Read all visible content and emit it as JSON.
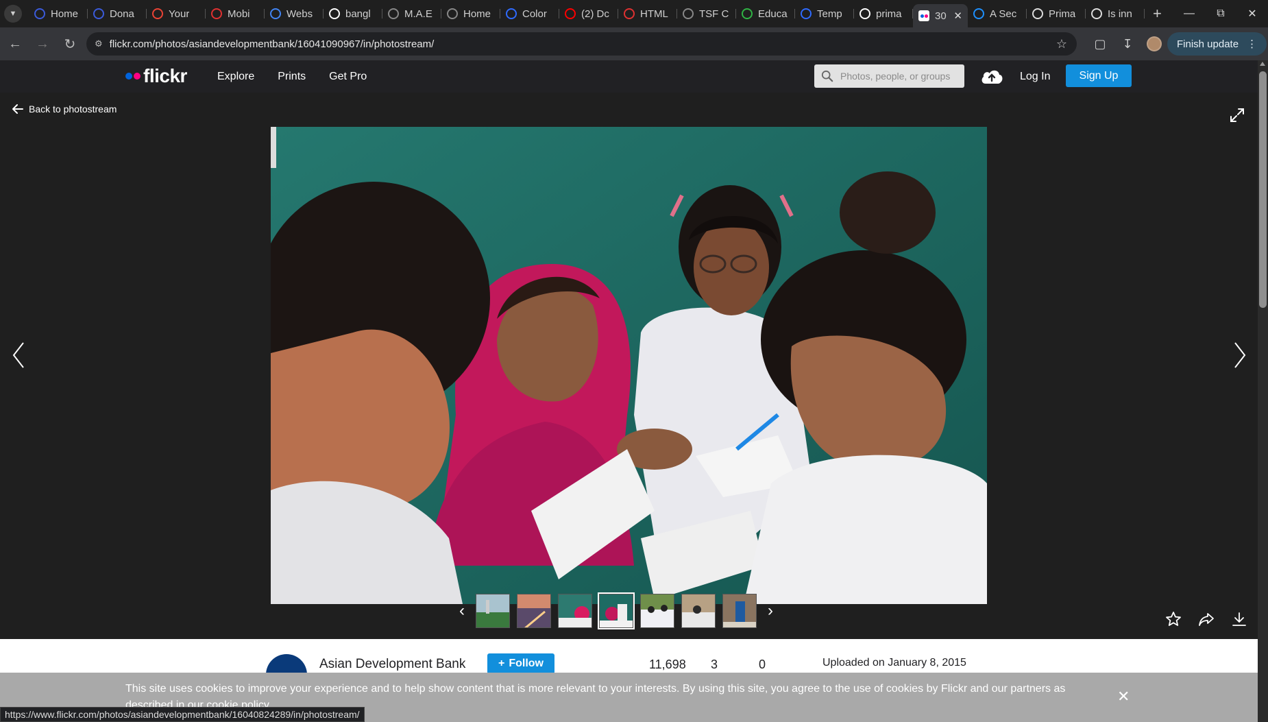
{
  "browser": {
    "tabs": [
      {
        "label": "Home",
        "favicon": "globe-icon",
        "color": "#3b5bdb"
      },
      {
        "label": "Dona",
        "favicon": "globe-icon",
        "color": "#3b5bdb"
      },
      {
        "label": "Your",
        "favicon": "gmail-icon",
        "color": "#ea4335"
      },
      {
        "label": "Mobi",
        "favicon": "mobile-icon",
        "color": "#e03131"
      },
      {
        "label": "Webs",
        "favicon": "docs-icon",
        "color": "#4285f4"
      },
      {
        "label": "bangl",
        "favicon": "google-icon",
        "color": "#ffffff"
      },
      {
        "label": "M.A.E",
        "favicon": "globe-icon",
        "color": "#888888"
      },
      {
        "label": "Home",
        "favicon": "globe-icon",
        "color": "#888888"
      },
      {
        "label": "Color",
        "favicon": "canva-icon",
        "color": "#2f6bff"
      },
      {
        "label": "(2) Dc",
        "favicon": "youtube-icon",
        "color": "#ff0000"
      },
      {
        "label": "HTML",
        "favicon": "d-icon",
        "color": "#e03131"
      },
      {
        "label": "TSF C",
        "favicon": "globe-icon",
        "color": "#888888"
      },
      {
        "label": "Educa",
        "favicon": "mountain-icon",
        "color": "#2fb344"
      },
      {
        "label": "Temp",
        "favicon": "canva-icon",
        "color": "#2f6bff"
      },
      {
        "label": "prima",
        "favicon": "google-icon",
        "color": "#ffffff"
      },
      {
        "label": "30",
        "favicon": "flickr-icon",
        "color": "#ffffff",
        "active": true
      },
      {
        "label": "A Sec",
        "favicon": "site-icon",
        "color": "#1e90ff"
      },
      {
        "label": "Prima",
        "favicon": "site-icon",
        "color": "#dddddd"
      },
      {
        "label": "Is inn",
        "favicon": "site-icon",
        "color": "#dddddd"
      }
    ],
    "url": "flickr.com/photos/asiandevelopmentbank/16041090967/in/photostream/",
    "finish_update": "Finish update",
    "status_url": "https://www.flickr.com/photos/asiandevelopmentbank/16040824289/in/photostream/"
  },
  "flickr": {
    "logo_text": "flickr",
    "nav": [
      "Explore",
      "Prints",
      "Get Pro"
    ],
    "search_placeholder": "Photos, people, or groups",
    "login": "Log In",
    "signup": "Sign Up",
    "brand_blue": "#0063dc",
    "brand_pink": "#ff0084",
    "accent": "#128fdc"
  },
  "viewer": {
    "back": "Back to photostream",
    "thumbnail_count": 7,
    "current_thumbnail": 4
  },
  "meta": {
    "owner": "Asian Development Bank",
    "follow": "Follow",
    "stats": [
      "11,698",
      "3",
      "0"
    ],
    "uploaded": "Uploaded on January 8, 2015"
  },
  "cookie": {
    "text": "This site uses cookies to improve your experience and to help show content that is more relevant to your interests. By using this site, you agree to the use of cookies by Flickr and our partners as described in our cookie policy."
  }
}
